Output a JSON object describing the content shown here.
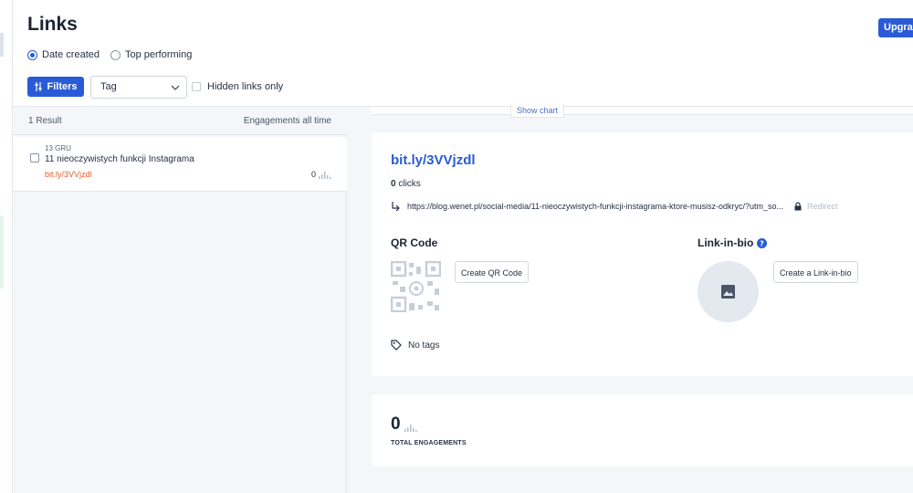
{
  "header": {
    "title": "Links",
    "upgrade_label": "Upgrade",
    "sort_options": [
      {
        "label": "Date created",
        "selected": true
      },
      {
        "label": "Top performing",
        "selected": false
      }
    ],
    "filters_label": "Filters",
    "tag_select": {
      "value": "Tag"
    },
    "hidden_links_label": "Hidden links only"
  },
  "list": {
    "result_count": "1 Result",
    "engagements_header": "Engagements all time",
    "items": [
      {
        "date": "13 GRU",
        "title": "11 nieoczywistych funkcji Instagrama",
        "short_link": "bit.ly/3VVjzdl",
        "engagements": "0"
      }
    ]
  },
  "detail": {
    "show_chart_label": "Show chart",
    "bitlink": "bit.ly/3VVjzdl",
    "clicks_count": "0",
    "clicks_label": "clicks",
    "destination_url": "https://blog.wenet.pl/social-media/11-nieoczywistych-funkcji-instagrama-ktore-musisz-odkryc/?utm_so...",
    "redirect_label": "Redirect",
    "qr_title": "QR Code",
    "create_qr_label": "Create QR Code",
    "bio_title": "Link-in-bio",
    "create_bio_label": "Create a Link-in-bio",
    "no_tags_label": "No tags"
  },
  "engagements": {
    "total": "0",
    "label": "TOTAL ENGAGEMENTS"
  },
  "colors": {
    "primary": "#2a5bd7",
    "short_link_orange": "#e35d2d",
    "background": "#f4f6fa"
  }
}
